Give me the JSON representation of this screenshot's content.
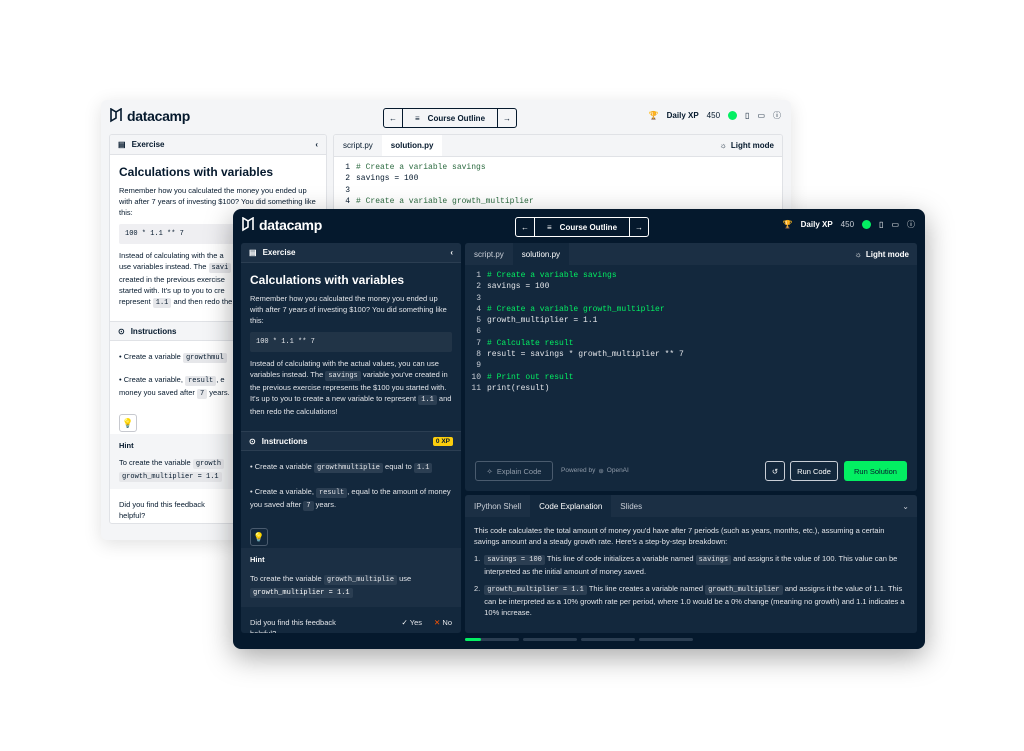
{
  "brand": {
    "name": "datacamp"
  },
  "nav": {
    "course_outline": "Course Outline",
    "prev_icon": "arrow-left-icon",
    "next_icon": "arrow-right-icon",
    "menu_icon": "list-icon"
  },
  "header_right": {
    "daily_xp_label": "Daily XP",
    "daily_xp_value": "450"
  },
  "exercise_panel": {
    "title": "Exercise",
    "heading": "Calculations with variables",
    "intro": "Remember how you calculated the money you ended up with after 7 years of investing $100? You did something like this:",
    "code_example": "100 * 1.1 ** 7",
    "para_pre_savings": "Instead of calculating with the actual values, you can use variables instead. The",
    "para_savings": "savings",
    "para_mid": "variable you've created in the previous exercise represents the $100 you started with. It's up to you to create a new variable to represent",
    "para_value": "1.1",
    "para_end": "and then redo the calculations!",
    "light_para_a": "Instead of calculating with the a",
    "light_para_b": "use variables instead. The",
    "light_para_b_chip": "savi",
    "light_para_c": "created in the previous exercise",
    "light_para_d": "started with. It's up to you to cre",
    "light_para_e": "represent",
    "light_para_e_chip": "1.1",
    "light_para_e_tail": "and then redo the"
  },
  "instructions": {
    "title": "Instructions",
    "xp_badge": "0 XP",
    "item1_pre": "Create a variable",
    "item1_chip": "growthmultiplie",
    "item1_mid": "equal to",
    "item1_chip2": "1.1",
    "item2_pre": "Create a variable,",
    "item2_chip": "result",
    "item2_mid": ", equal to the amount of money you saved after",
    "item2_chip2": "7",
    "item2_end": "years.",
    "light_item1_chip": "growthmul",
    "light_item2_mid": ", e",
    "light_item2_line2": "money you saved after",
    "light_item2_end": "years."
  },
  "hint": {
    "title": "Hint",
    "text_pre": "To create the variable",
    "chip1": "growth_multiplie",
    "text_mid": "use",
    "chip2": "growth_multiplier = 1.1",
    "light_chip1": "growth",
    "light_chip2": "growth_multiplier = 1.1"
  },
  "feedback": {
    "question": "Did you find this feedback helpful?",
    "yes": "Yes",
    "no": "No"
  },
  "editor": {
    "tabs": [
      "script.py",
      "solution.py"
    ],
    "light_mode": "Light mode",
    "lines": [
      {
        "n": "1",
        "text": "# Create a variable savings",
        "comment": true
      },
      {
        "n": "2",
        "text": "savings = 100",
        "comment": false
      },
      {
        "n": "3",
        "text": "",
        "comment": false
      },
      {
        "n": "4",
        "text": "# Create a variable growth_multiplier",
        "comment": true
      },
      {
        "n": "5",
        "text": "growth_multiplier = 1.1",
        "comment": false
      },
      {
        "n": "6",
        "text": "",
        "comment": false
      },
      {
        "n": "7",
        "text": "# Calculate result",
        "comment": true
      },
      {
        "n": "8",
        "text": "result = savings * growth_multiplier ** 7",
        "comment": false
      },
      {
        "n": "9",
        "text": "",
        "comment": false
      },
      {
        "n": "10",
        "text": "# Print out result",
        "comment": true
      },
      {
        "n": "11",
        "text": "print(result)",
        "comment": false
      }
    ],
    "explain_code": "Explain Code",
    "powered_by": "Powered by",
    "openai": "OpenAI",
    "run_code": "Run Code",
    "run_solution": "Run Solution"
  },
  "bottom": {
    "tabs": [
      "IPython Shell",
      "Code Explanation",
      "Slides"
    ],
    "intro": "This code calculates the total amount of money you'd have after 7 periods (such as years, months, etc.), assuming a certain savings amount and a steady growth rate. Here's a step-by-step breakdown:",
    "items": [
      {
        "num": "1.",
        "chip": "savings = 100",
        "pre": "This line of code initializes a variable named",
        "chip2": "savings",
        "post": "and assigns it the value of 100. This value can be interpreted as the initial amount of money saved."
      },
      {
        "num": "2.",
        "chip": "growth_multiplier = 1.1",
        "pre": "This line creates a variable named",
        "chip2": "growth_multiplier",
        "post": "and assigns it the value of 1.1. This can be interpreted as a 10% growth rate per period, where 1.0 would be a 0% change (meaning no growth) and 1.1 indicates a 10% increase."
      }
    ]
  },
  "colors": {
    "green": "#03ef62",
    "navy": "#05192d",
    "panel_dark": "#13283d",
    "badge_yellow": "#fcce0d",
    "no_red": "#ff5400"
  }
}
